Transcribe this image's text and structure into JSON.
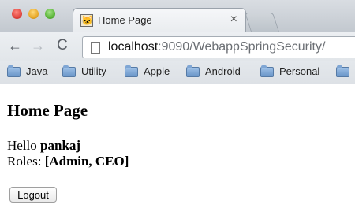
{
  "browser": {
    "tab": {
      "title": "Home Page",
      "close_glyph": "×"
    },
    "nav": {
      "back_glyph": "←",
      "forward_glyph": "→",
      "reload_glyph": "C"
    },
    "address": {
      "host": "localhost",
      "rest": ":9090/WebappSpringSecurity/"
    },
    "bookmarks": [
      "Java",
      "Utility",
      "Apple",
      "Android",
      "Personal"
    ]
  },
  "page": {
    "heading": "Home Page",
    "hello_prefix": "Hello",
    "username": "pankaj",
    "roles_prefix": "Roles:",
    "roles": "[Admin, CEO]",
    "logout_label": "Logout"
  }
}
